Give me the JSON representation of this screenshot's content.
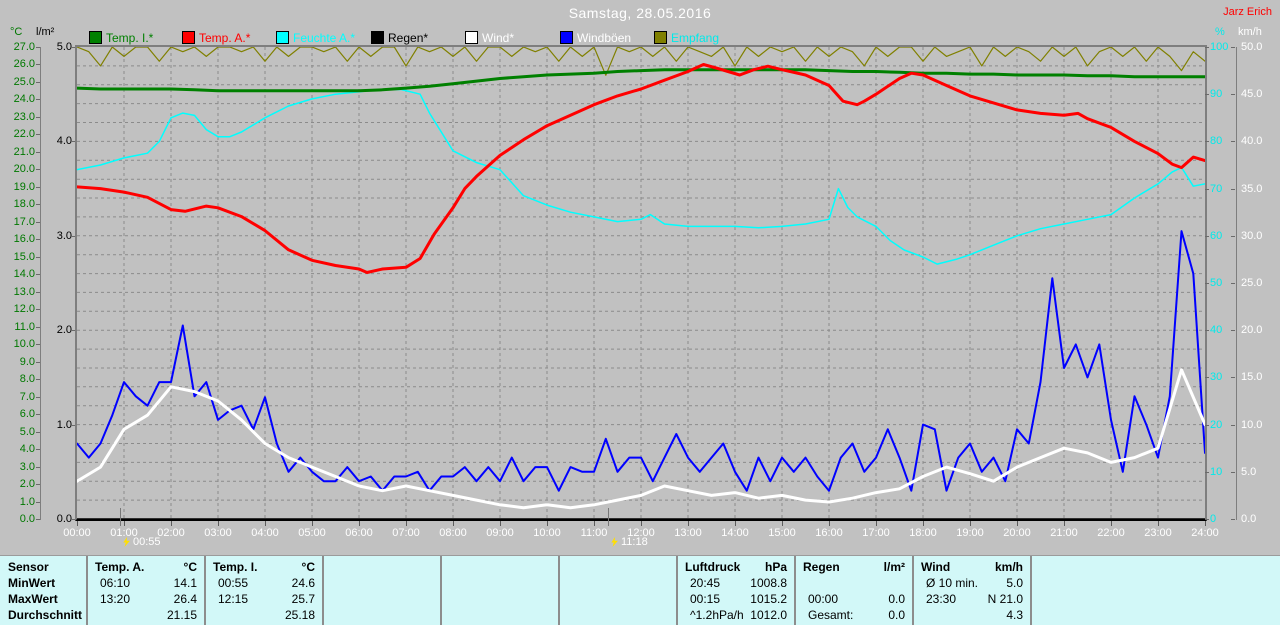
{
  "header": {
    "title": "Samstag, 28.05.2016",
    "author": "Jarz Erich"
  },
  "axis_units": {
    "left_temp": "°C",
    "left_rain": "l/m²",
    "right_humidity": "%",
    "right_wind": "km/h"
  },
  "legend": {
    "items": [
      {
        "label": "Temp. I.*",
        "color": "#008000",
        "text_color": "#008000"
      },
      {
        "label": "Temp. A.*",
        "color": "#ff0000",
        "text_color": "#ff0000"
      },
      {
        "label": "Feuchte A.*",
        "color": "#00ffff",
        "text_color": "#00ffff"
      },
      {
        "label": "Regen*",
        "color": "#000000",
        "text_color": "#000000"
      },
      {
        "label": "Wind*",
        "color": "#ffffff",
        "text_color": "#ffffff"
      },
      {
        "label": "Windböen",
        "color": "#0000ff",
        "text_color": "#ffffff"
      },
      {
        "label": "Empfang",
        "color": "#808000",
        "text_color": "#00eaea"
      }
    ]
  },
  "chart_data": {
    "type": "line",
    "title": "Samstag, 28.05.2016",
    "x_axis": {
      "unit": "hour",
      "min": 0,
      "max": 24,
      "tick_labels": [
        "00:00",
        "01:00",
        "02:00",
        "03:00",
        "04:00",
        "05:00",
        "06:00",
        "07:00",
        "08:00",
        "09:00",
        "10:00",
        "11:00",
        "12:00",
        "13:00",
        "14:00",
        "15:00",
        "16:00",
        "17:00",
        "18:00",
        "19:00",
        "20:00",
        "21:00",
        "22:00",
        "23:00",
        "24:00"
      ]
    },
    "axes": {
      "temp": {
        "label": "°C",
        "min": 0,
        "max": 27,
        "step": 1,
        "decimals": 1,
        "side": "left",
        "color": "#007800"
      },
      "rain": {
        "label": "l/m²",
        "min": 0,
        "max": 5,
        "step": 1,
        "decimals": 1,
        "side": "left",
        "color": "#000000"
      },
      "pct": {
        "label": "%",
        "min": 0,
        "max": 100,
        "step": 10,
        "decimals": 0,
        "side": "right",
        "color": "#00eaea"
      },
      "kmh": {
        "label": "km/h",
        "min": 0,
        "max": 50,
        "step": 5,
        "decimals": 1,
        "side": "right",
        "color": "#ffffff"
      }
    },
    "grid": {
      "h_divisions": 25,
      "v_divisions": 24,
      "style": "dashed"
    },
    "markers": [
      {
        "label": "00:55",
        "t": 0.92
      },
      {
        "label": "11:18",
        "t": 11.3
      }
    ],
    "series": [
      {
        "name": "Empfang",
        "axis": "pct",
        "color": "#808000",
        "width": 1.2,
        "z": 0,
        "x_start": 0,
        "x_step": 0.25,
        "values": [
          100,
          99,
          96,
          100,
          98,
          100,
          100,
          97,
          100,
          99,
          100,
          98,
          100,
          100,
          99,
          100,
          97,
          100,
          98,
          100,
          100,
          99,
          100,
          97,
          100,
          98,
          100,
          100,
          96,
          100,
          99,
          100,
          98,
          100,
          97,
          100,
          100,
          98,
          100,
          99,
          100,
          97,
          100,
          98,
          100,
          94,
          100,
          99,
          100,
          98,
          100,
          97,
          100,
          99,
          98,
          100,
          96,
          100,
          98,
          100,
          99,
          100,
          97,
          100,
          98,
          100,
          99,
          96,
          100,
          98,
          100,
          100,
          97,
          100,
          98,
          99,
          100,
          96,
          100,
          98,
          100,
          99,
          97,
          100,
          98,
          100,
          96,
          99,
          100,
          98,
          100,
          97,
          100,
          98,
          95,
          99,
          97
        ]
      },
      {
        "name": "Regen*",
        "axis": "rain",
        "color": "#000000",
        "width": 1.5,
        "z": 1,
        "x": [
          0,
          24
        ],
        "values": [
          0,
          0
        ]
      },
      {
        "name": "Feuchte A.*",
        "axis": "pct",
        "color": "#00ffff",
        "width": 1.5,
        "z": 2,
        "x": [
          0,
          0.5,
          1,
          1.5,
          1.75,
          2,
          2.25,
          2.5,
          2.75,
          3,
          3.25,
          3.5,
          4,
          4.5,
          5,
          5.5,
          6,
          6.5,
          6.9,
          7.3,
          7.5,
          8,
          8.5,
          9,
          9.5,
          10,
          10.5,
          11,
          11.5,
          12,
          12.2,
          12.5,
          13,
          13.5,
          14,
          14.5,
          15,
          15.5,
          16,
          16.2,
          16.4,
          16.6,
          17,
          17.3,
          17.6,
          18,
          18.3,
          18.7,
          19,
          19.5,
          20,
          20.5,
          21,
          21.5,
          22,
          22.5,
          23,
          23.3,
          23.5,
          23.75,
          24
        ],
        "values": [
          74,
          75,
          76.5,
          77.5,
          80,
          85,
          86,
          85.5,
          82.5,
          81,
          81,
          82,
          85,
          87.5,
          89,
          90,
          90.5,
          91,
          91,
          90,
          86,
          78,
          75.5,
          74,
          68.5,
          66.5,
          65,
          64,
          63,
          63.5,
          64.5,
          62.5,
          62,
          62,
          62,
          61.7,
          62,
          62.5,
          63.5,
          70,
          66,
          64,
          62,
          59,
          57,
          55.5,
          54,
          55,
          56,
          58,
          60,
          61.5,
          62.5,
          63.5,
          64.5,
          68,
          71,
          73.5,
          74.5,
          70.5,
          71
        ]
      },
      {
        "name": "Windböen",
        "axis": "kmh",
        "color": "#0000ff",
        "width": 2,
        "z": 3,
        "x_start": 0,
        "x_step": 0.25,
        "values": [
          8,
          6.5,
          8,
          11,
          14.5,
          13,
          12,
          14.5,
          14.5,
          20.5,
          13,
          14.5,
          10.5,
          11.5,
          12,
          9.5,
          12.9,
          8,
          5,
          6.5,
          5,
          4,
          4,
          5.5,
          4,
          4.5,
          3,
          4.5,
          4.5,
          5,
          3,
          4.5,
          4.5,
          5.5,
          4,
          5.5,
          4,
          6.5,
          4,
          5.5,
          5.5,
          3,
          5.5,
          5,
          5,
          8.5,
          5,
          6.5,
          6.5,
          4,
          6.5,
          9,
          6.5,
          5,
          6.5,
          8,
          5,
          3,
          6.5,
          4,
          6.5,
          5,
          6.5,
          4.5,
          3,
          6.5,
          8,
          5,
          6.5,
          9.5,
          6.5,
          3,
          10,
          9.5,
          3,
          6.5,
          8,
          5,
          6.5,
          4,
          9.5,
          8,
          14.5,
          25.5,
          16,
          18.5,
          15,
          18.5,
          10.5,
          5,
          13,
          10,
          6.5,
          13,
          30.5,
          26,
          7
        ]
      },
      {
        "name": "Wind*",
        "axis": "kmh",
        "color": "#ffffff",
        "width": 3,
        "z": 4,
        "x_start": 0,
        "x_step": 0.5,
        "values": [
          4,
          5.5,
          9.5,
          11,
          14,
          13.5,
          12.5,
          10.5,
          8,
          6.5,
          5.5,
          4.5,
          3.5,
          3,
          3.5,
          3,
          2.5,
          2,
          1.5,
          1.2,
          1.5,
          1.2,
          1.5,
          2,
          2.5,
          3.5,
          3,
          2.5,
          2.8,
          2.2,
          2.5,
          2,
          1.8,
          2.2,
          2.8,
          3.2,
          4.5,
          5.5,
          4.8,
          4,
          5.5,
          6.5,
          7.5,
          7,
          6,
          6.5,
          7.5,
          15.8,
          10
        ]
      },
      {
        "name": "Temp. I.*",
        "axis": "temp",
        "color": "#008000",
        "width": 3,
        "z": 5,
        "x_start": 0,
        "x_step": 0.5,
        "values": [
          24.65,
          24.6,
          24.6,
          24.6,
          24.6,
          24.55,
          24.5,
          24.5,
          24.5,
          24.5,
          24.5,
          24.5,
          24.5,
          24.55,
          24.65,
          24.75,
          24.9,
          25.05,
          25.2,
          25.3,
          25.4,
          25.45,
          25.5,
          25.6,
          25.65,
          25.7,
          25.7,
          25.7,
          25.7,
          25.7,
          25.7,
          25.7,
          25.65,
          25.6,
          25.6,
          25.55,
          25.5,
          25.5,
          25.45,
          25.45,
          25.4,
          25.4,
          25.4,
          25.35,
          25.35,
          25.3,
          25.3,
          25.3,
          25.3
        ]
      },
      {
        "name": "Temp. A.*",
        "axis": "temp",
        "color": "#ff0000",
        "width": 3,
        "z": 6,
        "x": [
          0,
          0.5,
          1,
          1.5,
          2,
          2.3,
          2.75,
          3,
          3.5,
          4,
          4.5,
          5,
          5.5,
          6,
          6.17,
          6.5,
          7,
          7.3,
          7.6,
          8,
          8.25,
          8.5,
          9,
          9.5,
          10,
          10.5,
          11,
          11.5,
          12,
          12.5,
          13,
          13.33,
          13.6,
          14.1,
          14.4,
          14.7,
          15,
          15.5,
          16,
          16.3,
          16.6,
          16.75,
          17,
          17.5,
          17.75,
          18,
          18.5,
          19,
          19.5,
          20,
          20.5,
          21,
          21.3,
          21.5,
          22,
          22.5,
          23,
          23.3,
          23.5,
          23.75,
          24
        ],
        "values": [
          19.0,
          18.9,
          18.7,
          18.4,
          17.7,
          17.6,
          17.9,
          17.8,
          17.3,
          16.5,
          15.4,
          14.8,
          14.5,
          14.3,
          14.1,
          14.3,
          14.4,
          14.9,
          16.3,
          17.8,
          18.9,
          19.6,
          20.8,
          21.7,
          22.5,
          23.1,
          23.7,
          24.2,
          24.6,
          25.1,
          25.6,
          26.0,
          25.8,
          25.4,
          25.7,
          25.9,
          25.7,
          25.4,
          24.8,
          23.9,
          23.7,
          23.9,
          24.3,
          25.2,
          25.5,
          25.4,
          24.8,
          24.2,
          23.8,
          23.4,
          23.2,
          23.1,
          23.2,
          22.9,
          22.4,
          21.6,
          20.9,
          20.3,
          20.1,
          20.7,
          20.5
        ]
      }
    ]
  },
  "table": {
    "row_labels": [
      "Sensor",
      "MinWert",
      "MaxWert",
      "Durchschnitt"
    ],
    "columns": [
      {
        "name": "Temp. A.",
        "unit": "°C",
        "min_time": "06:10",
        "min_val": "14.1",
        "max_time": "13:20",
        "max_val": "26.4",
        "avg_label": "",
        "avg_val": "21.15"
      },
      {
        "name": "Temp. I.",
        "unit": "°C",
        "min_time": "00:55",
        "min_val": "24.6",
        "max_time": "12:15",
        "max_val": "25.7",
        "avg_label": "",
        "avg_val": "25.18"
      },
      {
        "name": "Luftdruck",
        "unit": "hPa",
        "min_time": "20:45",
        "min_val": "1008.8",
        "max_time": "00:15",
        "max_val": "1015.2",
        "avg_label": "^1.2hPa/h",
        "avg_val": "1012.0"
      },
      {
        "name": "Regen",
        "unit": "l/m²",
        "min_time": "",
        "min_val": "",
        "max_time": "00:00",
        "max_val": "0.0",
        "avg_label": "Gesamt:",
        "avg_val": "0.0"
      },
      {
        "name": "Wind",
        "unit": "km/h",
        "min_time": "Ø 10 min.",
        "min_val": "5.0",
        "max_time": "23:30",
        "max_val": "N 21.0",
        "avg_label": "",
        "avg_val": "4.3"
      }
    ]
  }
}
